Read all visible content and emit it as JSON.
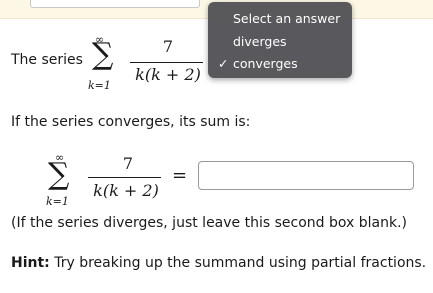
{
  "series_sentence": {
    "label": "The series",
    "sum_upper": "∞",
    "sum_lower": "k=1",
    "numerator": "7",
    "denominator": "k(k + 2)"
  },
  "dropdown": {
    "options": [
      "Select an answer",
      "diverges",
      "converges"
    ],
    "selected": "converges",
    "check_mark": "✓"
  },
  "sum_question": {
    "prompt": "If the series converges, its sum is:",
    "sum_upper": "∞",
    "sum_lower": "k=1",
    "numerator": "7",
    "denominator": "k(k + 2)",
    "equals": "=",
    "answer_value": ""
  },
  "note": "(If the series diverges, just leave this second box blank.)",
  "hint": {
    "label": "Hint:",
    "text": " Try breaking up the summand using partial fractions."
  }
}
